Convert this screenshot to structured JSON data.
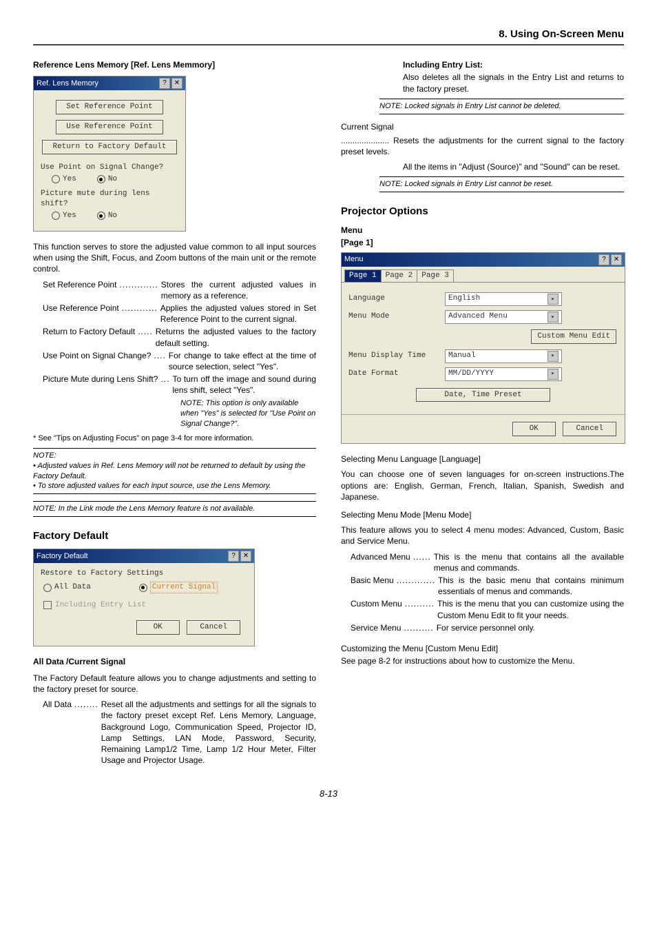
{
  "header": {
    "title": "8. Using On-Screen Menu"
  },
  "left": {
    "ref_lens_heading": "Reference Lens Memory [Ref. Lens Memmory]",
    "dlg_reflens": {
      "title": "Ref. Lens Memory",
      "btn_set": "Set Reference Point",
      "btn_use": "Use Reference Point",
      "btn_return": "Return to Factory Default",
      "q_point": "Use Point on Signal Change?",
      "q_mute": "Picture mute during lens shift?",
      "opt_yes": "Yes",
      "opt_no": "No"
    },
    "reflens_desc": "This function serves to store the adjusted value common to all input sources when using the Shift, Focus, and Zoom buttons of the main unit or the remote control.",
    "defs": {
      "set_term": "Set Reference Point",
      "set_dots": ".............",
      "set_desc": "Stores the current adjusted values in memory as a reference.",
      "use_term": "Use Reference Point",
      "use_dots": "............",
      "use_desc": "Applies the adjusted values stored in Set Reference Point to the current signal.",
      "ret_term": "Return to Factory Default",
      "ret_dots": ".....",
      "ret_desc": "Returns the adjusted values to the factory default setting.",
      "upt_term": "Use Point on Signal Change?",
      "upt_dots": "....",
      "upt_desc": "For change to take effect at the time of source selection, select \"Yes\".",
      "pic_term": "Picture Mute during Lens Shift?",
      "pic_dots": "...",
      "pic_desc": "To turn off the image and sound during lens shift, select \"Yes\".",
      "pic_note": "NOTE: This option is only available when \"Yes\" is selected for \"Use Point on Signal Change?\"."
    },
    "star": "* See \"Tips on Adjusting Focus\" on page 3-4 for more information.",
    "notes_block": {
      "label": "NOTE:",
      "line1": "• Adjusted values in Ref. Lens Memory will not be returned to default by using the Factory Default.",
      "line2": "• To store adjusted values for each input source, use the Lens Memory."
    },
    "link_note": "NOTE: In the Link mode the Lens Memory feature is not available.",
    "factory_heading": "Factory Default",
    "dlg_factory": {
      "title": "Factory Default",
      "restore_label": "Restore to Factory Settings",
      "opt_all": "All Data",
      "opt_current": "Current Signal",
      "inc_entry": "Including Entry List",
      "ok": "OK",
      "cancel": "Cancel"
    },
    "fd_subhead": "All Data /Current Signal",
    "fd_desc": "The Factory Default feature allows you to change adjustments and setting to the factory preset for source.",
    "fd_all_term": "All Data",
    "fd_all_dots": "........",
    "fd_all_desc": "Reset all the adjustments and settings for all the signals to the factory preset except Ref. Lens Memory, Language, Background Logo, Communication Speed, Projector ID, Lamp Settings, LAN Mode, Password, Security, Remaining Lamp1/2 Time, Lamp 1/2 Hour Meter, Filter Usage and Projector Usage."
  },
  "right": {
    "inc_heading": "Including Entry List:",
    "inc_desc": "Also deletes all the signals in the Entry List and returns to the factory preset.",
    "inc_note": "NOTE: Locked signals in Entry List cannot be deleted.",
    "cur_label": "Current Signal",
    "cur_dots": ".....................",
    "cur_desc": "Resets the adjustments for the current signal to the factory preset levels.",
    "cur_desc2": "All the items in \"Adjust (Source)\" and \"Sound\" can be reset.",
    "cur_note": "NOTE: Locked signals in Entry List cannot be reset.",
    "proj_heading": "Projector Options",
    "menu_sub": "Menu",
    "page1_label": "[Page 1]",
    "dlg_menu": {
      "title": "Menu",
      "tab1": "Page 1",
      "tab2": "Page 2",
      "tab3": "Page 3",
      "lang_label": "Language",
      "lang_val": "English",
      "mode_label": "Menu Mode",
      "mode_val": "Advanced Menu",
      "custom_btn": "Custom Menu Edit",
      "disp_label": "Menu Display Time",
      "disp_val": "Manual",
      "date_label": "Date Format",
      "date_val": "MM/DD/YYYY",
      "preset_btn": "Date, Time Preset",
      "ok": "OK",
      "cancel": "Cancel"
    },
    "lang_head": "Selecting Menu Language [Language]",
    "lang_desc": "You can choose one of seven languages for on-screen instructions.The options are: English, German, French, Italian, Spanish, Swedish and Japanese.",
    "mode_head": "Selecting Menu Mode [Menu Mode]",
    "mode_desc": "This feature allows you to select 4 menu modes: Advanced, Custom, Basic and Service Menu.",
    "adv_term": "Advanced Menu",
    "adv_dots": "......",
    "adv_desc": "This is the menu that contains all the available menus and commands.",
    "bas_term": "Basic Menu",
    "bas_dots": ".............",
    "bas_desc": "This is the basic menu that contains minimum essentials of menus and commands.",
    "cus_term": "Custom Menu",
    "cus_dots": "..........",
    "cus_desc": "This is the menu that you can customize using the Custom Menu Edit to fit your needs.",
    "srv_term": "Service Menu",
    "srv_dots": "..........",
    "srv_desc": "For service personnel only.",
    "cust_head": "Customizing the Menu [Custom Menu Edit]",
    "cust_desc": "See page 8-2 for instructions about how to customize the Menu."
  },
  "pagenum": "8-13"
}
